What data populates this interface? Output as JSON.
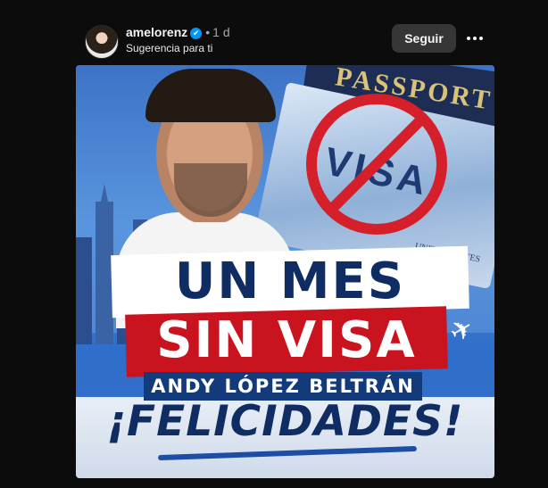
{
  "post": {
    "username": "amelorenz",
    "verified_mark": "✔",
    "separator": "•",
    "time": "1 d",
    "subtitle": "Sugerencia para ti",
    "follow_label": "Seguir",
    "more_icon": "three-dots-icon"
  },
  "image": {
    "passport_text": "PASSPORT",
    "visa_text": "VISA",
    "country_text": "UNITED STATES\nOF AMERICA",
    "headline_line1": "UN MES",
    "headline_line2": "SIN VISA",
    "name": "ANDY LÓPEZ BELTRÁN",
    "congrats": "¡FELICIDADES!",
    "plane_icon": "airplane-icon"
  },
  "colors": {
    "background": "#0c0c0c",
    "verified_blue": "#0095f6",
    "navy": "#0f2c63",
    "red": "#c9141f"
  }
}
